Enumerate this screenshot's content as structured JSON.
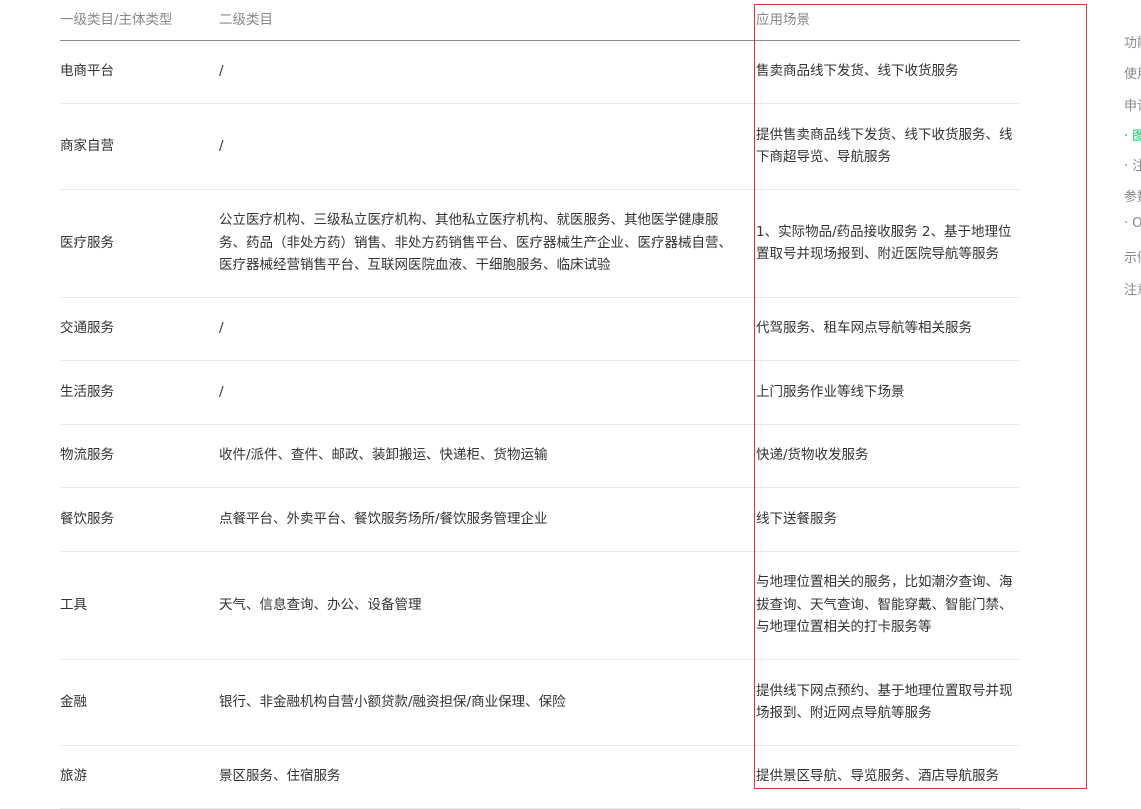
{
  "table": {
    "headers": [
      "一级类目/主体类型",
      "二级类目",
      "应用场景"
    ],
    "rows": [
      {
        "category": "电商平台",
        "subcategory": "/",
        "scenario": "售卖商品线下发货、线下收货服务"
      },
      {
        "category": "商家自营",
        "subcategory": "/",
        "scenario": "提供售卖商品线下发货、线下收货服务、线下商超导览、导航服务"
      },
      {
        "category": "医疗服务",
        "subcategory": "公立医疗机构、三级私立医疗机构、其他私立医疗机构、就医服务、其他医学健康服务、药品（非处方药）销售、非处方药销售平台、医疗器械生产企业、医疗器械自营、医疗器械经营销售平台、互联网医院血液、干细胞服务、临床试验",
        "scenario": "1、实际物品/药品接收服务 2、基于地理位置取号并现场报到、附近医院导航等服务"
      },
      {
        "category": "交通服务",
        "subcategory": "/",
        "scenario": "代驾服务、租车网点导航等相关服务"
      },
      {
        "category": "生活服务",
        "subcategory": "/",
        "scenario": "上门服务作业等线下场景"
      },
      {
        "category": "物流服务",
        "subcategory": "收件/派件、查件、邮政、装卸搬运、快递柜、货物运输",
        "scenario": "快递/货物收发服务"
      },
      {
        "category": "餐饮服务",
        "subcategory": "点餐平台、外卖平台、餐饮服务场所/餐饮服务管理企业",
        "scenario": "线下送餐服务"
      },
      {
        "category": "工具",
        "subcategory": "天气、信息查询、办公、设备管理",
        "scenario": "与地理位置相关的服务，比如潮汐查询、海拔查询、天气查询、智能穿戴、智能门禁、与地理位置相关的打卡服务等"
      },
      {
        "category": "金融",
        "subcategory": "银行、非金融机构自营小额贷款/融资担保/商业保理、保险",
        "scenario": "提供线下网点预约、基于地理位置取号并现场报到、附近网点导航等服务"
      },
      {
        "category": "旅游",
        "subcategory": "景区服务、住宿服务",
        "scenario": "提供景区导航、导览服务、酒店导航服务"
      }
    ]
  },
  "sidebar": {
    "items": [
      {
        "text": "功能",
        "style": "normal"
      },
      {
        "text": "使用",
        "style": "normal"
      },
      {
        "text": "申请",
        "style": "normal"
      },
      {
        "text": "· 图",
        "style": "green"
      },
      {
        "text": "· 注",
        "style": "normal"
      },
      {
        "text": "参数",
        "style": "normal"
      },
      {
        "text": "· O",
        "style": "normal"
      },
      {
        "text": "示例",
        "style": "normal"
      },
      {
        "text": "注意",
        "style": "normal"
      }
    ]
  },
  "colors": {
    "highlight_border": "#e0302f",
    "header_text": "#888888",
    "body_text": "#333333",
    "link_green": "#07c160"
  }
}
